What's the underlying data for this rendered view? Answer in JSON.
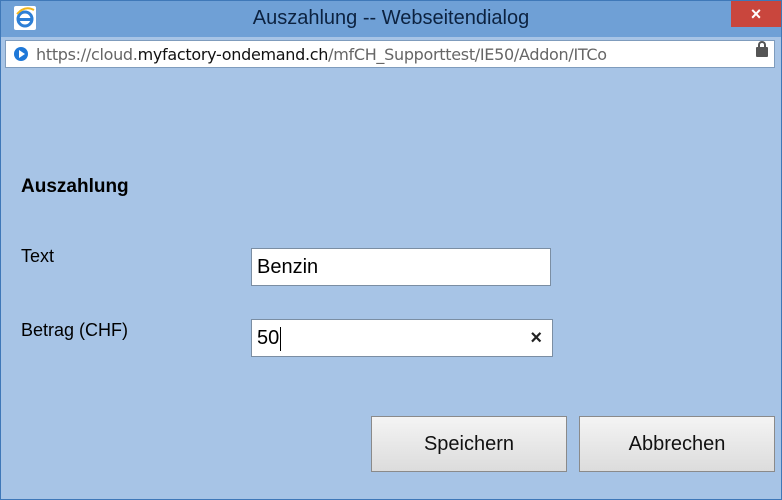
{
  "window": {
    "title": "Auszahlung -- Webseitendialog",
    "close_label": "×"
  },
  "address_bar": {
    "url_prefix": "https://cloud.",
    "url_domain": "myfactory-ondemand.ch",
    "url_path": "/mfCH_Supporttest/IE50/Addon/ITCo"
  },
  "form": {
    "title": "Auszahlung",
    "text_label": "Text",
    "text_value": "Benzin",
    "amount_label": "Betrag (CHF)",
    "amount_value": "50",
    "clear_label": "×"
  },
  "buttons": {
    "save": "Speichern",
    "cancel": "Abbrechen"
  },
  "colors": {
    "titlebar": "#6fa0d6",
    "dialog_bg": "#a7c4e6",
    "close": "#c9463d"
  }
}
